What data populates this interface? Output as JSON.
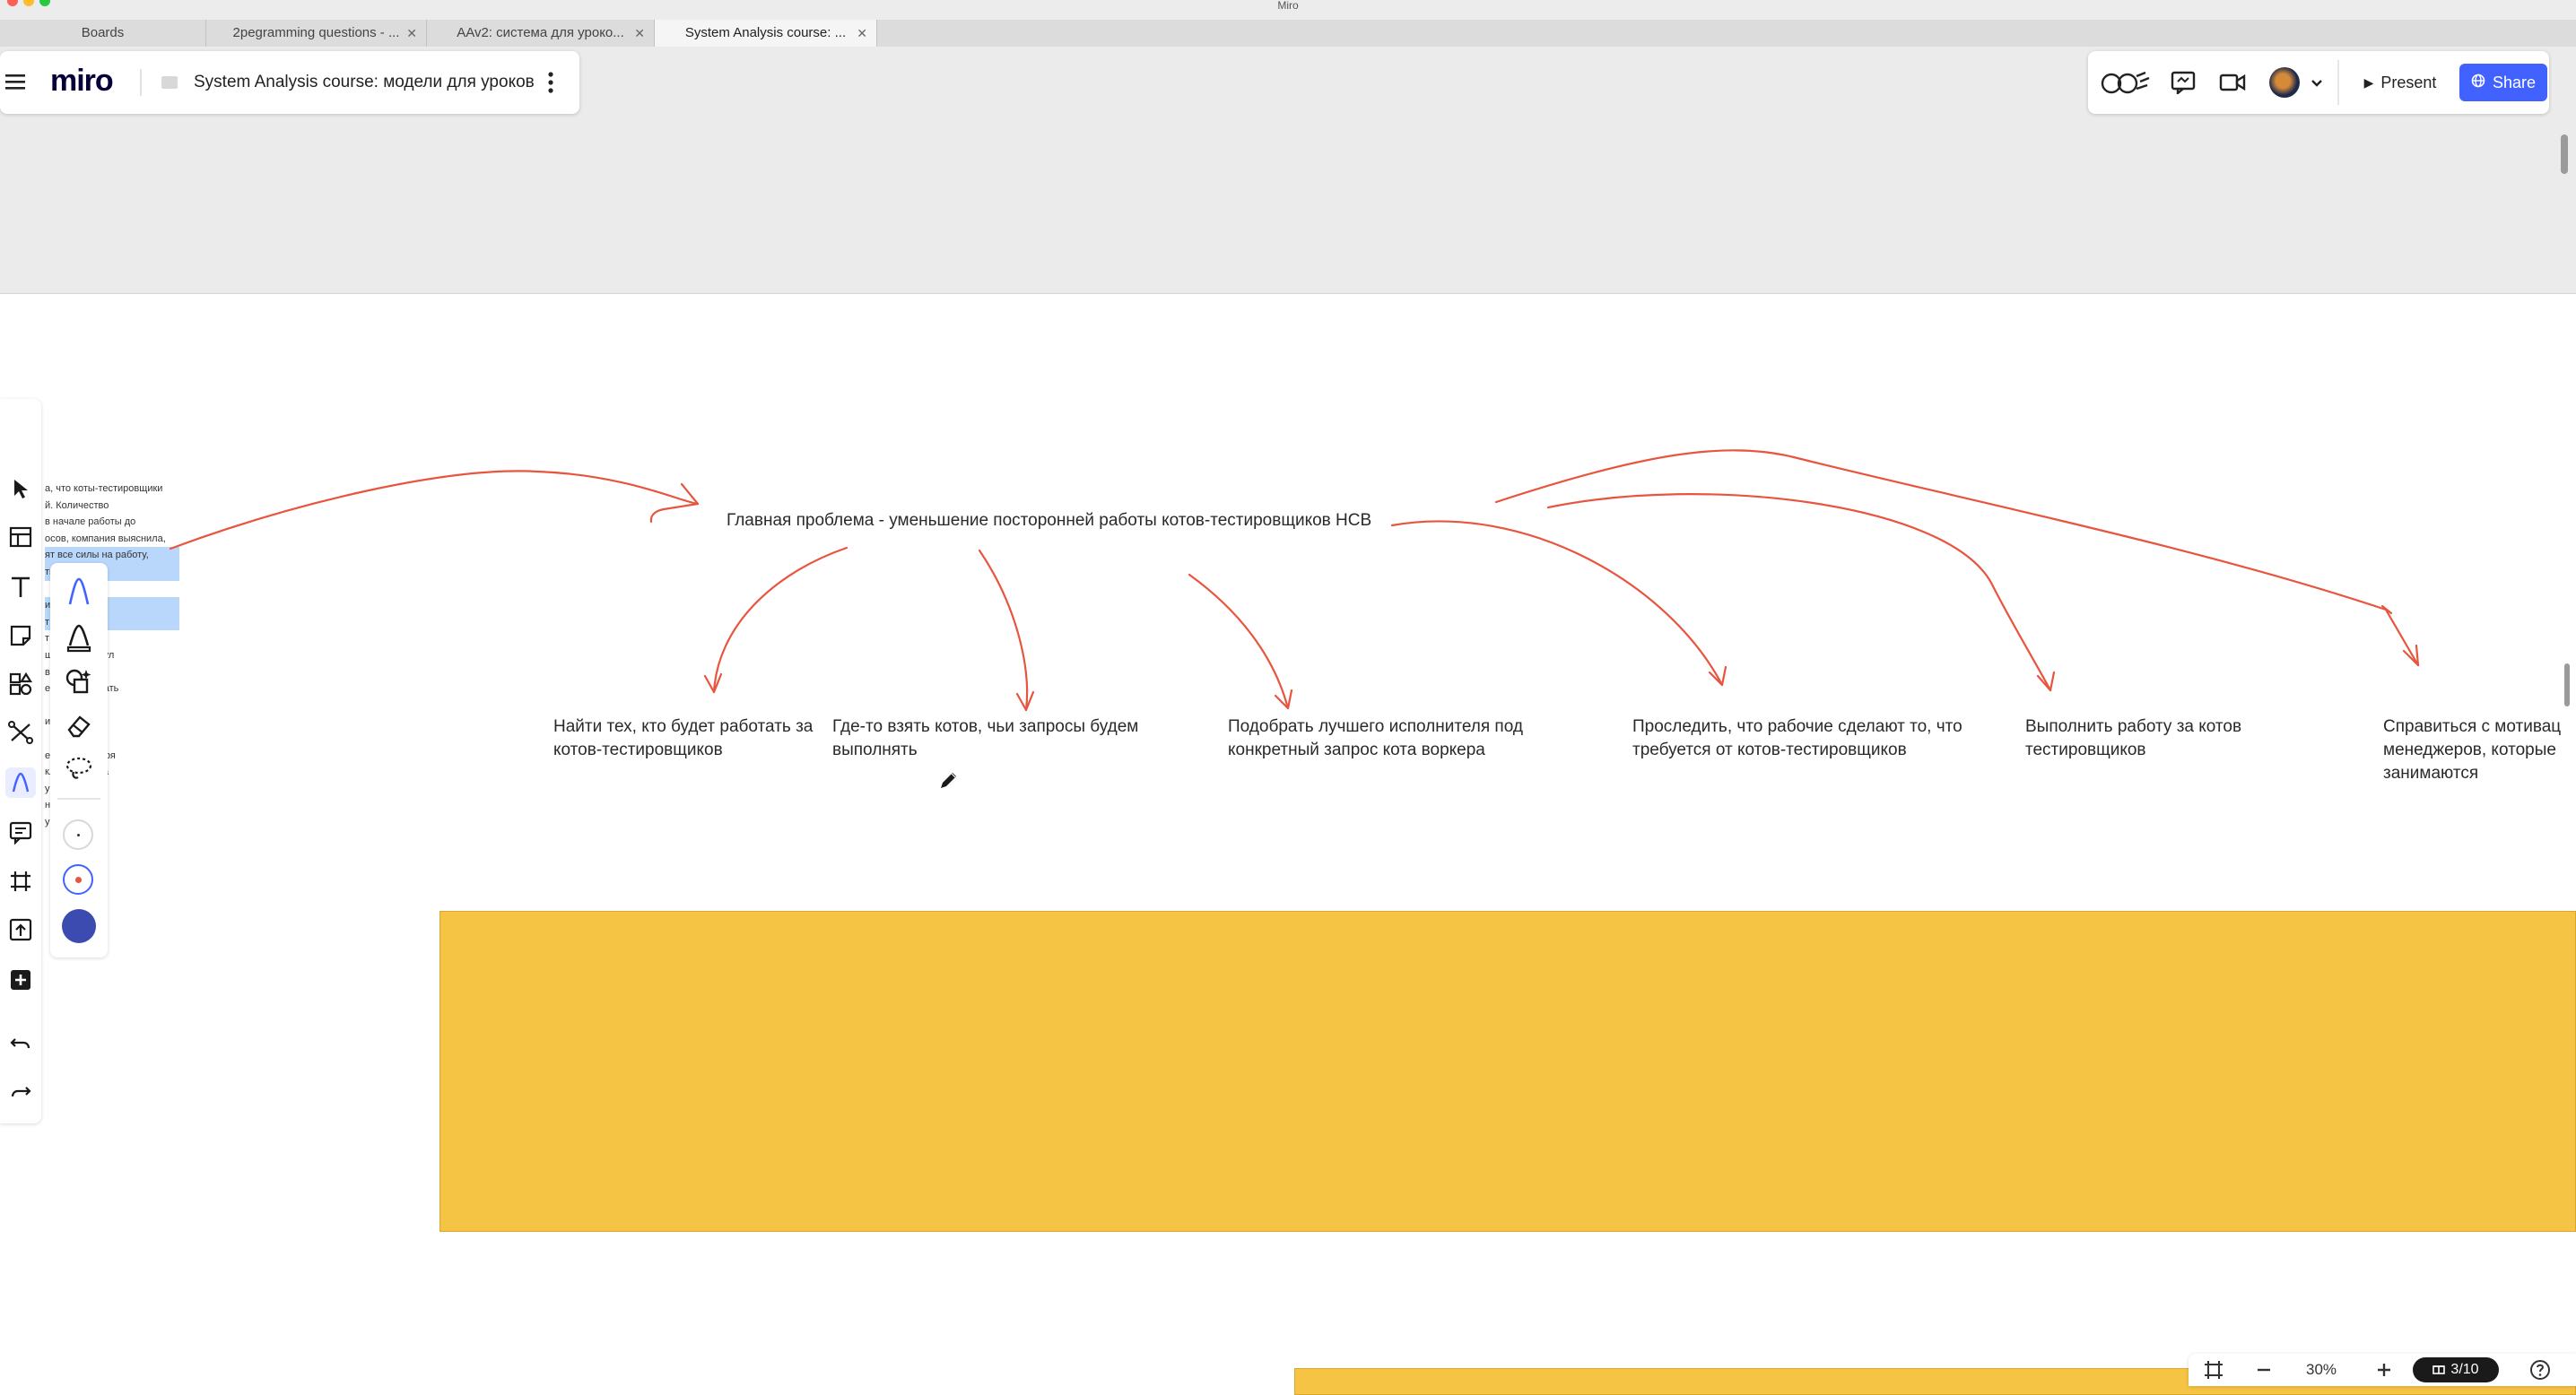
{
  "window": {
    "title": "Miro"
  },
  "browser_tabs": [
    {
      "label": "Boards",
      "active": false,
      "closable": false
    },
    {
      "label": "2pegramming questions - ...",
      "active": false,
      "closable": true
    },
    {
      "label": "AAv2: система для уроко...",
      "active": false,
      "closable": true
    },
    {
      "label": "System Analysis course: ...",
      "active": true,
      "closable": true
    }
  ],
  "header": {
    "logo": "miro",
    "board_title": "System Analysis course: модели для уроков",
    "present_label": "Present",
    "share_label": "Share"
  },
  "board": {
    "main_problem": "Главная проблема - уменьшение посторонней работы котов-тестировщиков НСВ",
    "tasks": [
      "Найти тех, кто будет работать за котов-тестировщиков",
      "Где-то взять котов, чьи запросы будем выполнять",
      "Подобрать лучшего исполнителя под конкретный запрос кота воркера",
      "Проследить, что рабочие сделают то, что требуется от котов-тестировщиков",
      "Выполнить работу за котов тестировщиков",
      "Справиться с мотивац менеджеров, которые занимаются"
    ],
    "side_text_lines": [
      "а, что коты-тестировщики",
      "й. Количество",
      "в начале работы до",
      "осов, компания выяснила,",
      "ят все силы на работу,",
      "ть          скидывать",
      "",
      "из          рочерную",
      "т ч           е",
      "т          овать",
      "ш          бранный пул",
      "в          телей",
      "е. В          ут получать",
      "",
      "и          и самый",
      "",
      "е          е). Благодаря",
      "кл          я этого она",
      "у          данный",
      "н          буется.",
      "у          ты."
    ]
  },
  "zoom": {
    "level": "30%",
    "pages": "3/10"
  },
  "colors": {
    "accent": "#4262ff",
    "arrows": "#e8553e",
    "sticky": "#f5c444",
    "selection": "#b8d7fb"
  }
}
